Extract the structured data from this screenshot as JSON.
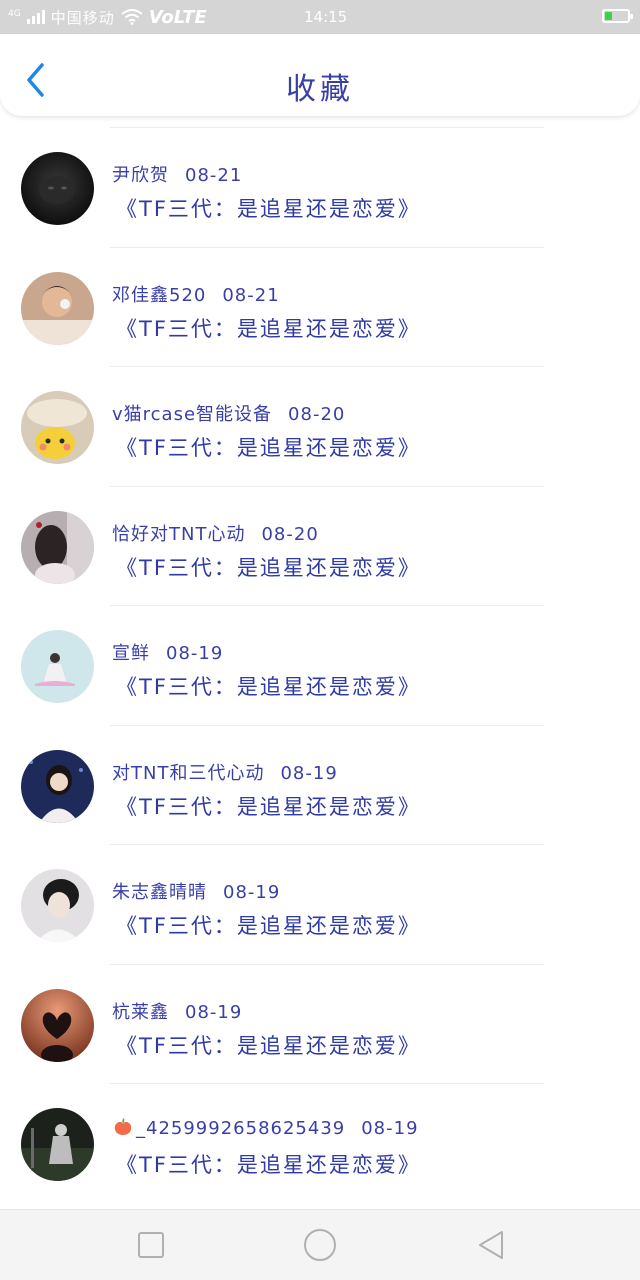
{
  "status_bar": {
    "network_small": "4G",
    "carrier": "中国移动",
    "volte": "VoLTE",
    "time": "14:15",
    "battery_level": 0.3,
    "battery_color": "#38d44b"
  },
  "header": {
    "title": "收藏",
    "back_icon": "chevron-left-icon",
    "accent_color": "#1e88e5"
  },
  "favorites": [
    {
      "author": "尹欣贺",
      "date": "08-21",
      "article": "《TF三代：是追星还是恋爱》"
    },
    {
      "author": "邓佳鑫520",
      "date": "08-21",
      "article": "《TF三代：是追星还是恋爱》"
    },
    {
      "author": "v猫rcase智能设备",
      "date": "08-20",
      "article": "《TF三代：是追星还是恋爱》"
    },
    {
      "author": "恰好对TNT心动",
      "date": "08-20",
      "article": "《TF三代：是追星还是恋爱》"
    },
    {
      "author": "宣鲜",
      "date": "08-19",
      "article": "《TF三代：是追星还是恋爱》"
    },
    {
      "author": "对TNT和三代心动",
      "date": "08-19",
      "article": "《TF三代：是追星还是恋爱》"
    },
    {
      "author": "朱志鑫晴晴",
      "date": "08-19",
      "article": "《TF三代：是追星还是恋爱》"
    },
    {
      "author": "杭莱鑫",
      "date": "08-19",
      "article": "《TF三代：是追星还是恋爱》"
    },
    {
      "author": "_4259992658625439",
      "author_prefix_icon": "peach-icon",
      "date": "08-19",
      "article": "《TF三代：是追星还是恋爱》"
    }
  ],
  "nav_bar": {
    "recent_icon": "square-icon",
    "home_icon": "circle-icon",
    "back_icon": "triangle-back-icon"
  }
}
